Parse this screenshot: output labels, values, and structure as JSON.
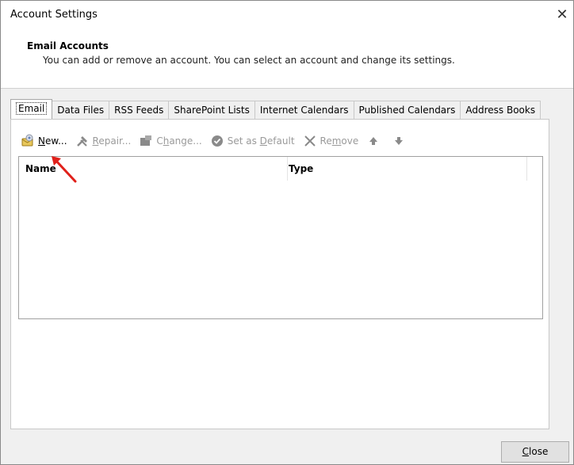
{
  "window": {
    "title": "Account Settings"
  },
  "header": {
    "title": "Email Accounts",
    "description": "You can add or remove an account. You can select an account and change its settings."
  },
  "tabs": [
    {
      "label": "Email"
    },
    {
      "label": "Data Files"
    },
    {
      "label": "RSS Feeds"
    },
    {
      "label": "SharePoint Lists"
    },
    {
      "label": "Internet Calendars"
    },
    {
      "label": "Published Calendars"
    },
    {
      "label": "Address Books"
    }
  ],
  "toolbar": {
    "new": {
      "prefix": "",
      "accel": "N",
      "rest": "ew..."
    },
    "repair": {
      "prefix": "",
      "accel": "R",
      "rest": "epair..."
    },
    "change": {
      "prefix": "C",
      "accel": "h",
      "rest": "ange..."
    },
    "set_default": {
      "prefix": "Set as ",
      "accel": "D",
      "rest": "efault"
    },
    "remove": {
      "prefix": "Re",
      "accel": "m",
      "rest": "ove"
    }
  },
  "list": {
    "columns": [
      "Name",
      "Type"
    ]
  },
  "footer": {
    "close": {
      "accel": "C",
      "rest": "lose"
    }
  },
  "colors": {
    "accent_arrow": "#e0201a",
    "disabled_text": "#9a9a9a"
  }
}
